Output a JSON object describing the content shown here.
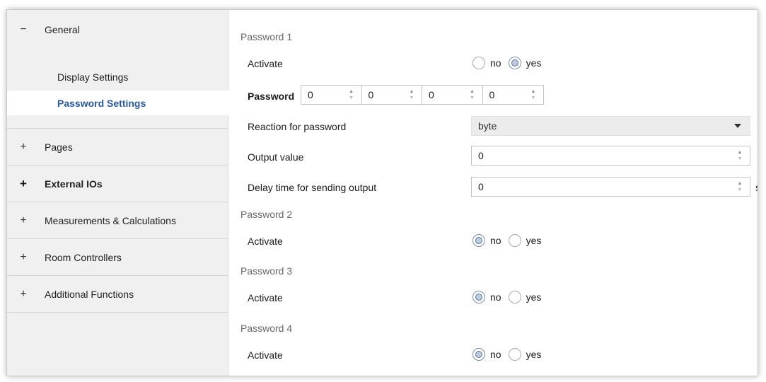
{
  "sidebar": {
    "general": {
      "sign": "−",
      "label": "General"
    },
    "sub_items": [
      {
        "label": "Display Settings"
      },
      {
        "label": "Password Settings"
      }
    ],
    "items": [
      {
        "sign": "+",
        "label": "Pages"
      },
      {
        "sign": "+",
        "label": "External IOs"
      },
      {
        "sign": "+",
        "label": "Measurements & Calculations"
      },
      {
        "sign": "+",
        "label": "Room Controllers"
      },
      {
        "sign": "+",
        "label": "Additional Functions"
      }
    ]
  },
  "main": {
    "password1": {
      "title": "Password 1",
      "activate_label": "Activate",
      "no_label": "no",
      "yes_label": "yes",
      "selected": "yes",
      "password_label": "Password",
      "digits": [
        "0",
        "0",
        "0",
        "0"
      ],
      "reaction_label": "Reaction for password",
      "reaction_value": "byte",
      "output_label": "Output value",
      "output_value": "0",
      "delay_label": "Delay time for sending output",
      "delay_value": "0",
      "delay_unit": "s"
    },
    "password2": {
      "title": "Password 2",
      "activate_label": "Activate",
      "no_label": "no",
      "yes_label": "yes",
      "selected": "no"
    },
    "password3": {
      "title": "Password 3",
      "activate_label": "Activate",
      "no_label": "no",
      "yes_label": "yes",
      "selected": "no"
    },
    "password4": {
      "title": "Password 4",
      "activate_label": "Activate",
      "no_label": "no",
      "yes_label": "yes",
      "selected": "no"
    }
  },
  "icons": {
    "spin_up": "spin-up-arrow",
    "spin_down": "spin-down-arrow",
    "dropdown": "caret-down-icon"
  }
}
